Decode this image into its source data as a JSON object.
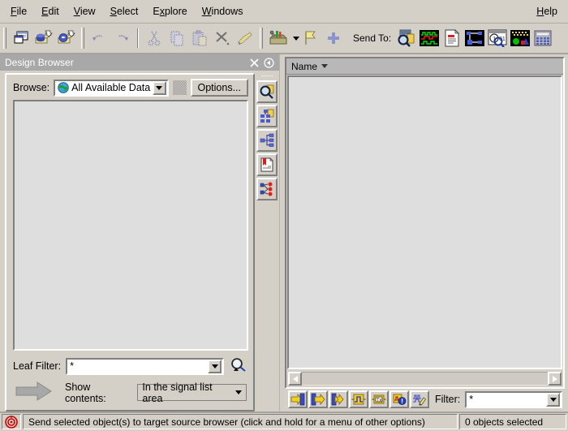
{
  "menu": {
    "items": [
      {
        "label": "File",
        "mnemonic": "F"
      },
      {
        "label": "Edit",
        "mnemonic": "E"
      },
      {
        "label": "View",
        "mnemonic": "V"
      },
      {
        "label": "Select",
        "mnemonic": "S"
      },
      {
        "label": "Explore",
        "mnemonic": "x"
      },
      {
        "label": "Windows",
        "mnemonic": "W"
      }
    ],
    "help_label": "Help"
  },
  "toolbar_left": {
    "buttons": [
      {
        "name": "new-window-icon",
        "title": "New Window"
      },
      {
        "name": "open-database-icon",
        "title": "Open Database"
      },
      {
        "name": "open-simulation-icon",
        "title": "Open Simulation"
      },
      {
        "name": "undo-icon",
        "title": "Undo"
      },
      {
        "name": "redo-icon",
        "title": "Redo"
      },
      {
        "name": "cut-icon",
        "title": "Cut"
      },
      {
        "name": "copy-icon",
        "title": "Copy"
      },
      {
        "name": "paste-icon",
        "title": "Paste"
      },
      {
        "name": "delete-icon",
        "title": "Delete"
      },
      {
        "name": "highlight-icon",
        "title": "Highlight"
      }
    ]
  },
  "toolbar_right": {
    "palette_label": "",
    "sendto_label": "Send To:",
    "buttons": [
      {
        "name": "toolbox-icon",
        "title": "Toolbox"
      },
      {
        "name": "probe-icon",
        "title": "Probe"
      },
      {
        "name": "marker-icon",
        "title": "Marker"
      },
      {
        "name": "send-to-browser-icon",
        "title": "Design Browser"
      },
      {
        "name": "send-to-waveform-icon",
        "title": "Waveform Window"
      },
      {
        "name": "send-to-source-icon",
        "title": "Source Browser"
      },
      {
        "name": "send-to-schematic-icon",
        "title": "Schematic Window"
      },
      {
        "name": "send-to-register-icon",
        "title": "Register Window"
      },
      {
        "name": "send-to-memory-icon",
        "title": "Memory Window"
      },
      {
        "name": "send-to-calculator-icon",
        "title": "Calculator"
      }
    ]
  },
  "design_browser": {
    "title": "Design Browser",
    "close_label": "×",
    "collapse_label": "◂",
    "browse_label": "Browse:",
    "browse_value": "All Available Data",
    "options_label": "Options...",
    "leaf_filter_label": "Leaf Filter:",
    "leaf_filter_value": "*",
    "show_contents_label": "Show contents:",
    "show_contents_value": "In the signal list area",
    "vertical_tools": [
      {
        "name": "find-icon",
        "title": "Find"
      },
      {
        "name": "scope-tree-icon",
        "title": "Scope Tree"
      },
      {
        "name": "hierarchy-icon",
        "title": "Hierarchy"
      },
      {
        "name": "source-file-icon",
        "title": "Source File"
      },
      {
        "name": "signal-tree-icon",
        "title": "Signal Tree"
      }
    ]
  },
  "signal_list": {
    "column_header": "Name",
    "sort_direction": "desc",
    "rows": [],
    "filter_label": "Filter:",
    "filter_value": "*",
    "toolbar_buttons": [
      {
        "name": "input-signal-icon",
        "title": "Inputs"
      },
      {
        "name": "output-signal-icon",
        "title": "Outputs"
      },
      {
        "name": "inout-signal-icon",
        "title": "Inouts"
      },
      {
        "name": "internal-signal-icon",
        "title": "Internal Signals"
      },
      {
        "name": "transaction-icon",
        "title": "Transactions"
      },
      {
        "name": "assertion-icon",
        "title": "Assertions"
      },
      {
        "name": "waveform-edit-icon",
        "title": "Waveform Edit"
      }
    ]
  },
  "statusbar": {
    "icon_name": "target-icon",
    "message": "Send selected object(s) to target source browser (click and hold for a menu of other options)",
    "selection_count": "0  objects selected"
  },
  "colors": {
    "window_bg": "#d4d0c8",
    "title_bar": "#a8a8a8",
    "list_bg": "#dedede",
    "column_header": "#b8b8b8",
    "accent_blue": "#3040a0",
    "accent_yellow": "#ffe000",
    "accent_red": "#e00000",
    "accent_green": "#00c000"
  }
}
